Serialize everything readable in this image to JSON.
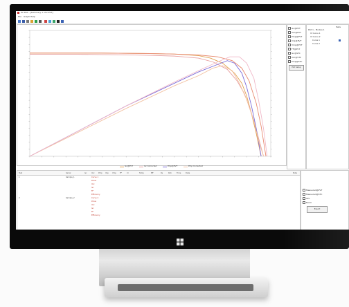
{
  "app": {
    "title": "PV Plot - [Summary 1 of 2 PVT]",
    "menu": [
      "File",
      "Graph",
      "Help"
    ],
    "toolbar_icons": [
      "open-icon",
      "save-icon",
      "print-icon",
      "copy-icon",
      "zoom-icon",
      "cursor-icon",
      "refresh-icon",
      "export-icon",
      "grid-icon",
      "camera-icon",
      "info-icon"
    ]
  },
  "right_panel": {
    "series_options": [
      "Isc@PVT",
      "Voc@PVT",
      "Pmp@PVT",
      "Imp@PVT",
      "Vmp@PVT",
      "FF@PVT",
      "Isc@STC",
      "Voc@STC",
      "Pmp@STC"
    ],
    "tree_title": "Tests",
    "tree_items": [
      "Plot 1 - Module 1",
      "IV Curve 1",
      "IV Curve 2",
      "Curve 1",
      "Curve 2"
    ],
    "options_button": "Plot Setup"
  },
  "legend": [
    "Isc@PVT",
    "Isc Corrected",
    "Pmp@PVT",
    "Pmp Corrected"
  ],
  "colors": {
    "series1": "#e0a050",
    "series2": "#e8a0a0",
    "series3": "#7a6ad8",
    "series4": "#f2c0a0",
    "linear": "#e88a70"
  },
  "table": {
    "headers": [
      "Test",
      "Serial",
      "Isc",
      "Voc",
      "Pmp",
      "Imp",
      "Vmp",
      "FF",
      "Irr",
      "Temp",
      "Eff",
      "Rs",
      "Rsh",
      "Time",
      "Date",
      "Note"
    ],
    "rows": [
      [
        "1",
        "Sample_1",
        "",
        "Curve 1",
        "",
        "",
        "",
        "",
        "",
        "",
        "",
        "",
        "",
        "",
        "",
        ""
      ],
      [
        "",
        "",
        "",
        "Pmax",
        "",
        "",
        "",
        "",
        "",
        "",
        "",
        "",
        "",
        "",
        "",
        ""
      ],
      [
        "",
        "",
        "",
        "Voc",
        "",
        "",
        "",
        "",
        "",
        "",
        "",
        "",
        "",
        "",
        "",
        ""
      ],
      [
        "",
        "",
        "",
        "Isc",
        "",
        "",
        "",
        "",
        "",
        "",
        "",
        "",
        "",
        "",
        "",
        ""
      ],
      [
        "",
        "",
        "",
        "FF",
        "",
        "",
        "",
        "",
        "",
        "",
        "",
        "",
        "",
        "",
        "",
        ""
      ],
      [
        "",
        "",
        "",
        "Efficiency",
        "",
        "",
        "",
        "",
        "",
        "",
        "",
        "",
        "",
        "",
        "",
        ""
      ],
      [
        "2",
        "Sample_2",
        "",
        "Curve 2",
        "",
        "",
        "",
        "",
        "",
        "",
        "",
        "",
        "",
        "",
        "",
        ""
      ],
      [
        "",
        "",
        "",
        "Pmax",
        "",
        "",
        "",
        "",
        "",
        "",
        "",
        "",
        "",
        "",
        "",
        ""
      ],
      [
        "",
        "",
        "",
        "Voc",
        "",
        "",
        "",
        "",
        "",
        "",
        "",
        "",
        "",
        "",
        "",
        ""
      ],
      [
        "",
        "",
        "",
        "Isc",
        "",
        "",
        "",
        "",
        "",
        "",
        "",
        "",
        "",
        "",
        "",
        ""
      ],
      [
        "",
        "",
        "",
        "FF",
        "",
        "",
        "",
        "",
        "",
        "",
        "",
        "",
        "",
        "",
        "",
        ""
      ],
      [
        "",
        "",
        "",
        "Efficiency",
        "",
        "",
        "",
        "",
        "",
        "",
        "",
        "",
        "",
        "",
        "",
        ""
      ]
    ]
  },
  "bottom_panel": {
    "checks": [
      "Measured@PVT",
      "Measured@STC",
      "STC",
      "Norm"
    ],
    "button": "Export"
  },
  "chart_data": {
    "type": "line",
    "xlim": [
      0,
      100
    ],
    "ylim": [
      0,
      100
    ],
    "series": [
      {
        "x": [
          0,
          10,
          20,
          30,
          40,
          50,
          60,
          70,
          75,
          80,
          85,
          88,
          90,
          92,
          94,
          96
        ],
        "y": [
          82,
          82,
          82,
          82,
          81.8,
          81.6,
          81.2,
          80,
          78,
          74,
          66,
          58,
          48,
          34,
          18,
          0
        ]
      },
      {
        "x": [
          0,
          10,
          20,
          30,
          40,
          50,
          60,
          70,
          76,
          82,
          86,
          89,
          91,
          93,
          95,
          97
        ],
        "y": [
          81,
          81,
          81,
          80.8,
          80.6,
          80.2,
          79.6,
          78,
          75,
          69,
          60,
          50,
          40,
          28,
          14,
          0
        ]
      },
      {
        "x": [
          0,
          20,
          40,
          60,
          70,
          78,
          82,
          85,
          88,
          90,
          92,
          94,
          96
        ],
        "y": [
          0,
          20,
          40,
          58,
          67,
          73,
          76,
          74,
          66,
          55,
          40,
          22,
          0
        ]
      },
      {
        "x": [
          0,
          20,
          40,
          60,
          70,
          76,
          80,
          84,
          87,
          90,
          93,
          95,
          97
        ],
        "y": [
          0,
          19,
          38,
          56,
          64,
          70,
          72,
          68,
          58,
          45,
          28,
          12,
          0
        ]
      },
      {
        "x": [
          0,
          10,
          20,
          30,
          40,
          50,
          60,
          70,
          78,
          84,
          88,
          91,
          94,
          96,
          98
        ],
        "y": [
          82,
          82,
          82,
          82,
          81.8,
          81.6,
          81.2,
          80.5,
          79,
          76,
          70,
          60,
          42,
          24,
          0
        ]
      },
      {
        "x": [
          0,
          20,
          40,
          60,
          70,
          78,
          83,
          87,
          90,
          93,
          95,
          97,
          98.5
        ],
        "y": [
          0,
          20,
          40,
          59,
          68,
          75,
          79,
          79,
          74,
          62,
          44,
          22,
          0
        ]
      }
    ]
  }
}
